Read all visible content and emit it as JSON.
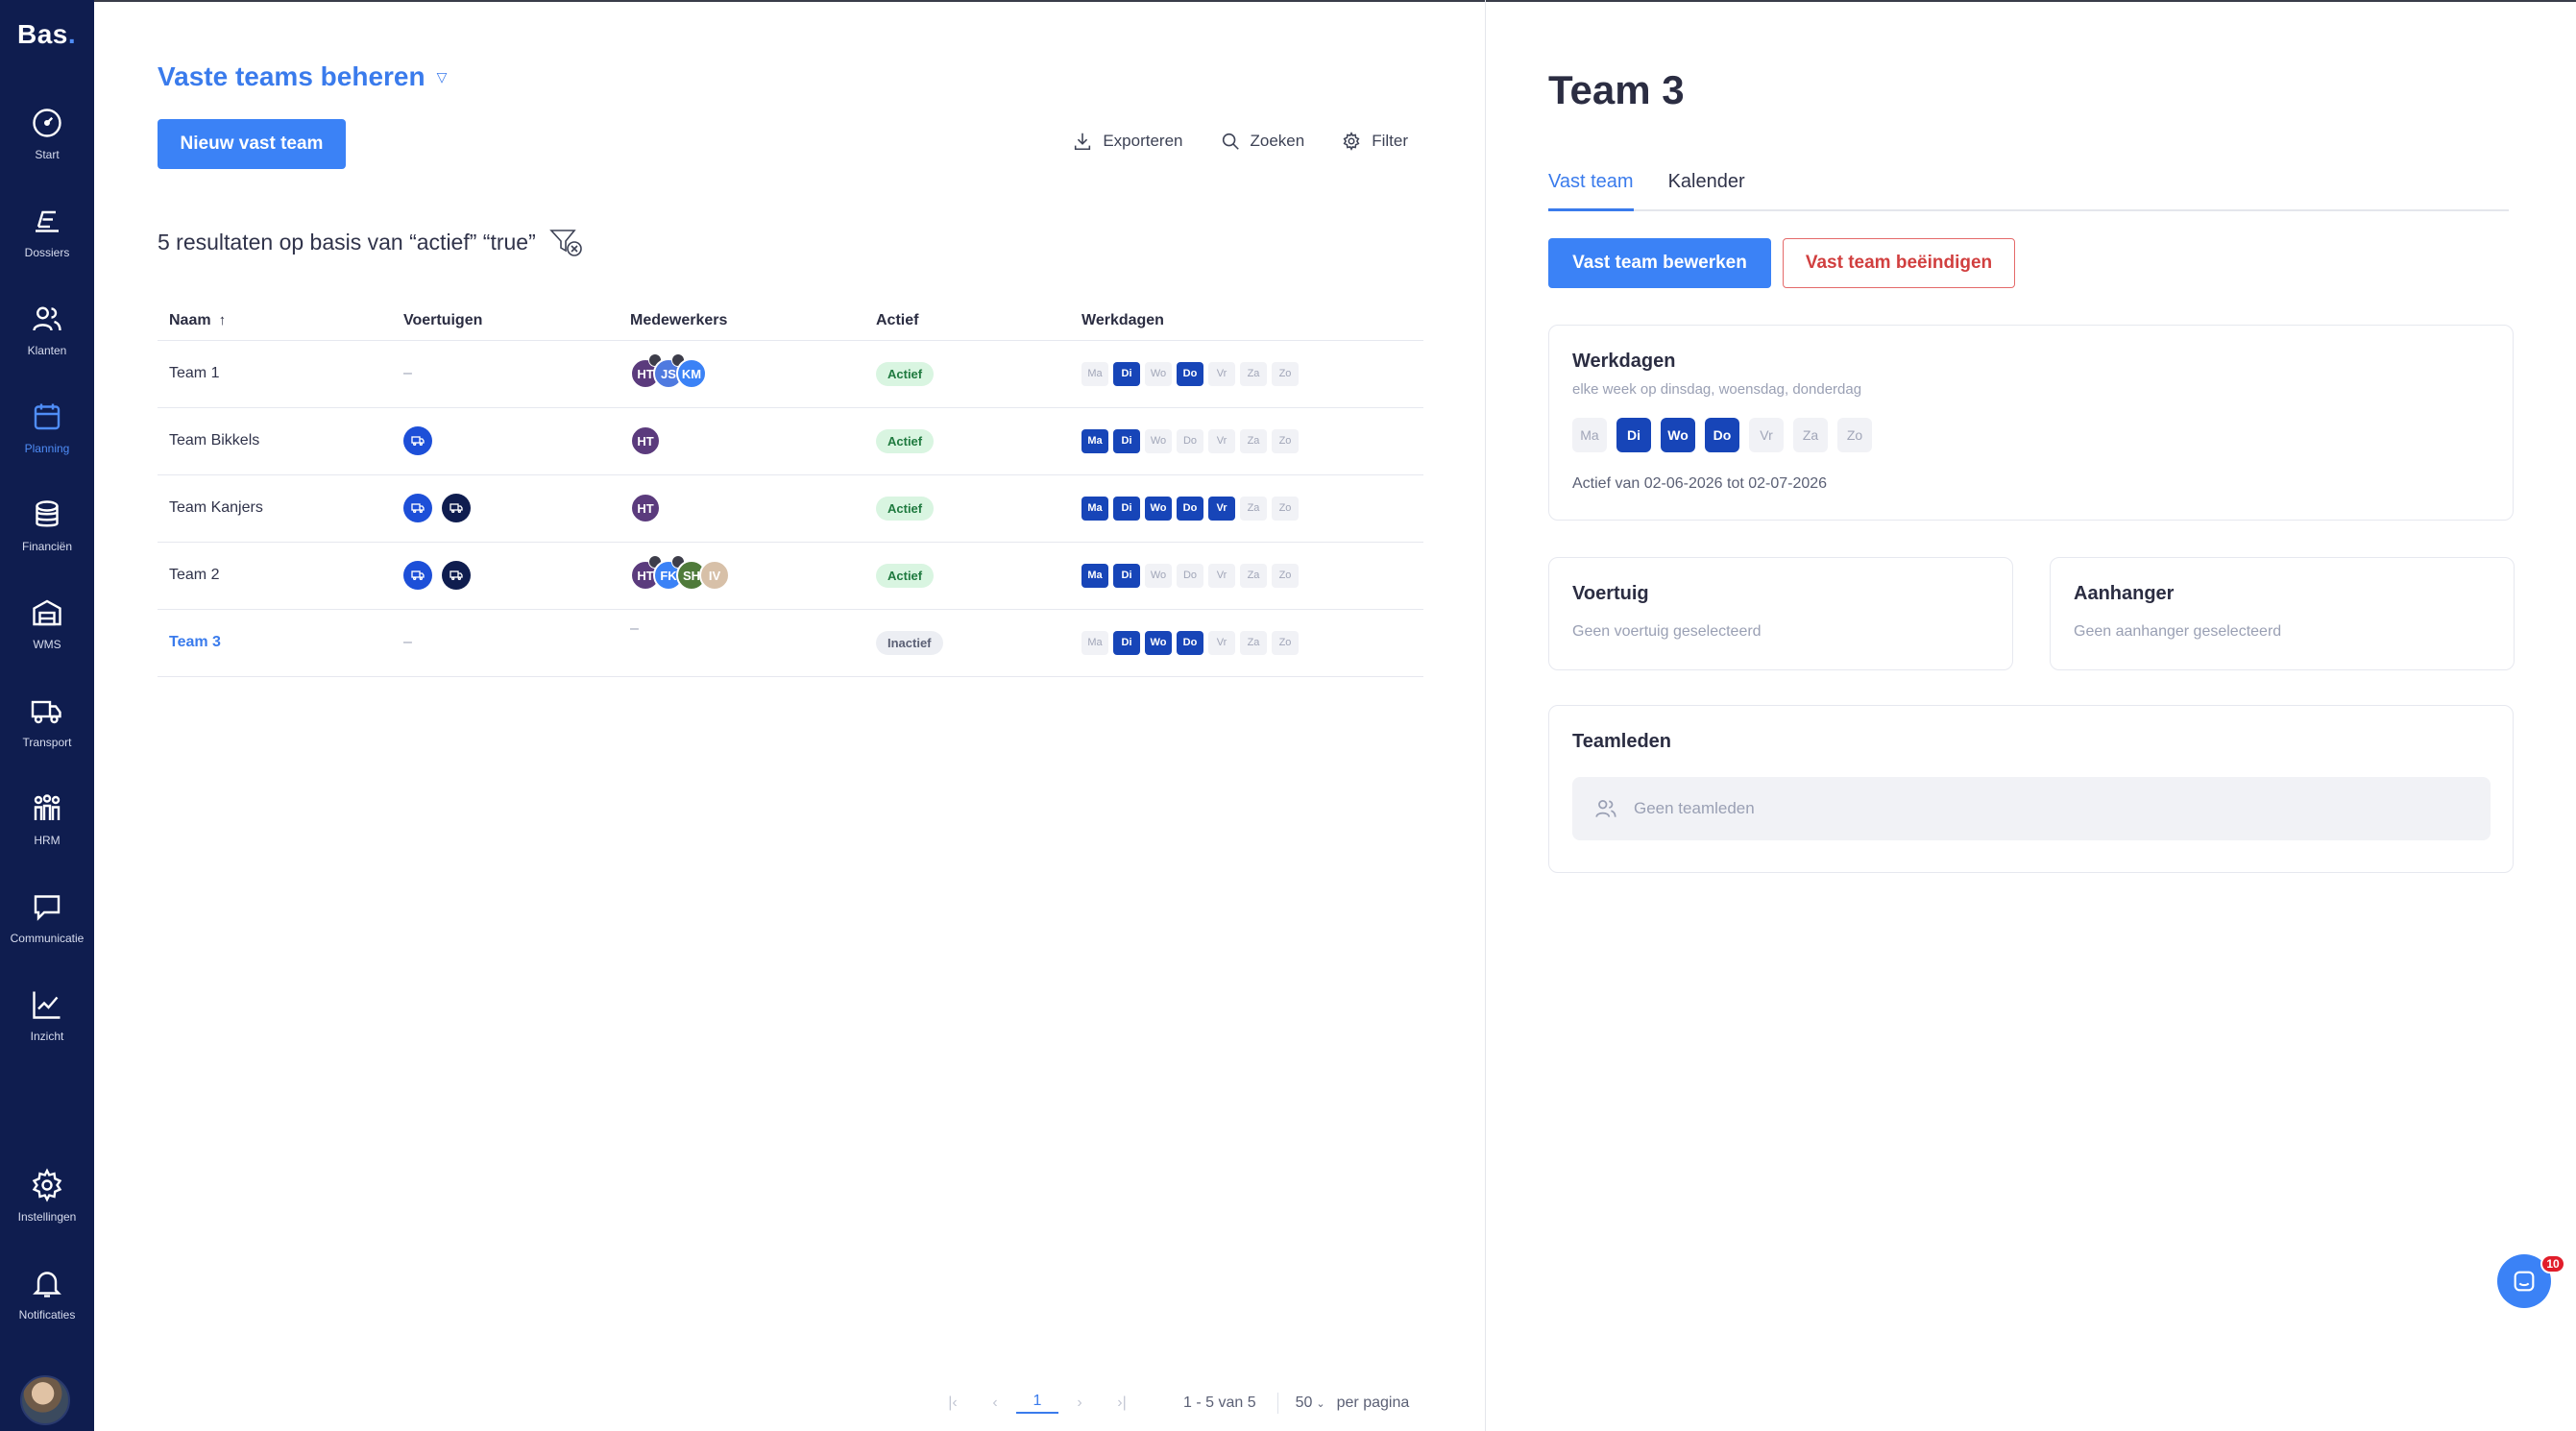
{
  "app": {
    "logo": "Bas",
    "logo_dot": "."
  },
  "nav": [
    {
      "label": "Start",
      "icon": "speedometer-icon"
    },
    {
      "label": "Dossiers",
      "icon": "dossiers-icon"
    },
    {
      "label": "Klanten",
      "icon": "users-icon"
    },
    {
      "label": "Planning",
      "icon": "calendar-icon",
      "active": true
    },
    {
      "label": "Financiën",
      "icon": "coins-icon"
    },
    {
      "label": "WMS",
      "icon": "warehouse-icon"
    },
    {
      "label": "Transport",
      "icon": "truck-icon"
    },
    {
      "label": "HRM",
      "icon": "team-icon"
    },
    {
      "label": "Communicatie",
      "icon": "chat-icon"
    },
    {
      "label": "Inzicht",
      "icon": "chart-line-icon"
    }
  ],
  "nav_bottom": [
    {
      "label": "Instellingen",
      "icon": "gear-icon"
    },
    {
      "label": "Notificaties",
      "icon": "bell-icon"
    }
  ],
  "page": {
    "title": "Vaste teams beheren",
    "new_button": "Nieuw vast team",
    "toolbar": {
      "export": "Exporteren",
      "search": "Zoeken",
      "filter": "Filter"
    },
    "results_text": "5 resultaten op basis van “actief” “true”"
  },
  "table": {
    "headers": [
      "Naam",
      "Voertuigen",
      "Medewerkers",
      "Actief",
      "Werkdagen"
    ],
    "day_labels": [
      "Ma",
      "Di",
      "Wo",
      "Do",
      "Vr",
      "Za",
      "Zo"
    ],
    "rows": [
      {
        "name": "Team 1",
        "vehicles": "–",
        "employees": [
          {
            "init": "HT",
            "color": "#5b3b7d",
            "sub": true
          },
          {
            "init": "JS",
            "color": "#4f7ae0",
            "sub": true
          },
          {
            "init": "KM",
            "color": "#3b82f6"
          }
        ],
        "status": "Actief",
        "days": [
          0,
          1,
          0,
          1,
          0,
          0,
          0
        ]
      },
      {
        "name": "Team Bikkels",
        "vehicles": [
          "blue"
        ],
        "employees": [
          {
            "init": "HT",
            "color": "#5b3b7d"
          }
        ],
        "status": "Actief",
        "days": [
          1,
          1,
          0,
          0,
          0,
          0,
          0
        ]
      },
      {
        "name": "Team Kanjers",
        "vehicles": [
          "blue",
          "dark"
        ],
        "employees": [
          {
            "init": "HT",
            "color": "#5b3b7d"
          }
        ],
        "status": "Actief",
        "days": [
          1,
          1,
          1,
          1,
          1,
          0,
          0
        ]
      },
      {
        "name": "Team 2",
        "vehicles": [
          "blue",
          "dark"
        ],
        "employees": [
          {
            "init": "HT",
            "color": "#5b3b7d",
            "sub": true
          },
          {
            "init": "FK",
            "color": "#3b82f6",
            "sub": true
          },
          {
            "init": "SH",
            "color": "#4f7a3a"
          },
          {
            "init": "IV",
            "color": "#d7c0a8"
          }
        ],
        "status": "Actief",
        "days": [
          1,
          1,
          0,
          0,
          0,
          0,
          0
        ]
      },
      {
        "name": "Team 3",
        "vehicles": "–",
        "employees": "–",
        "status": "Inactief",
        "days": [
          0,
          1,
          1,
          1,
          0,
          0,
          0
        ],
        "selected": true
      }
    ]
  },
  "pagination": {
    "first": "|‹",
    "prev": "‹",
    "current": "1",
    "next": "›",
    "last": "›|",
    "range": "1 - 5 van 5",
    "per_page_value": "50",
    "per_page_label": "per pagina"
  },
  "detail": {
    "title": "Team 3",
    "tabs": [
      "Vast team",
      "Kalender"
    ],
    "edit_button": "Vast team bewerken",
    "end_button": "Vast team beëindigen",
    "werkdagen": {
      "title": "Werkdagen",
      "subtitle": "elke week op dinsdag, woensdag, donderdag",
      "days": [
        0,
        1,
        1,
        1,
        0,
        0,
        0
      ],
      "active_text": "Actief van 02-06-2026 tot 02-07-2026"
    },
    "voertuig": {
      "title": "Voertuig",
      "empty": "Geen voertuig geselecteerd"
    },
    "aanhanger": {
      "title": "Aanhanger",
      "empty": "Geen aanhanger geselecteerd"
    },
    "teamleden": {
      "title": "Teamleden",
      "empty": "Geen teamleden"
    }
  },
  "chat": {
    "badge": "10"
  },
  "colors": {
    "sidebar": "#0f1d4f",
    "accent": "#3b82f6",
    "day_on": "#1745b8",
    "danger": "#d13f3f"
  }
}
